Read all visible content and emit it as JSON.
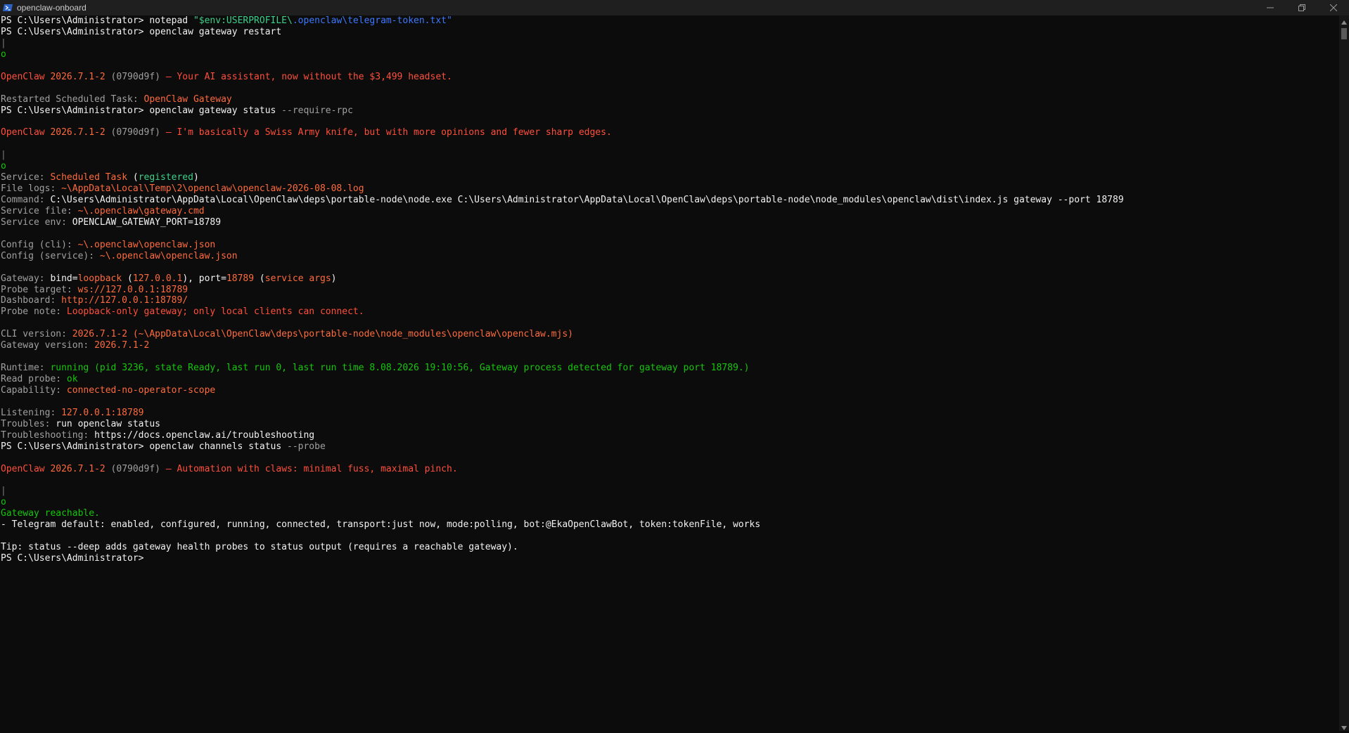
{
  "window": {
    "title": "openclaw-onboard",
    "icons": {
      "app": "powershell-icon",
      "minimize": "minimize-icon",
      "restore": "restore-icon",
      "close": "close-icon"
    }
  },
  "terminal": {
    "colors": {
      "background": "#0c0c0c",
      "text": "#cccccc",
      "accent_orange": "#ff6b3d",
      "accent_red": "#ff4f3b",
      "success_green": "#16c60c",
      "prompt_white": "#f2f2f2"
    },
    "lines": [
      [
        {
          "t": "PS C:\\Users\\Administrator> ",
          "c": "w"
        },
        {
          "t": "notepad ",
          "c": "w"
        },
        {
          "t": "\"$env:USERPROFILE\\",
          "c": "gs"
        },
        {
          "t": ".openclaw\\telegram-token.txt\"",
          "c": "bl"
        }
      ],
      [
        {
          "t": "PS C:\\Users\\Administrator> ",
          "c": "w"
        },
        {
          "t": "openclaw gateway restart",
          "c": "w"
        }
      ],
      [
        {
          "t": "|",
          "c": "dim"
        }
      ],
      [
        {
          "t": "o",
          "c": "gr"
        }
      ],
      [],
      [
        {
          "t": "OpenClaw ",
          "c": "or"
        },
        {
          "t": "2026.7.1-2 ",
          "c": "o"
        },
        {
          "t": "(0790d9f) ",
          "c": "g"
        },
        {
          "t": "— Your AI assistant, now without the $3,499 headset.",
          "c": "or"
        }
      ],
      [],
      [
        {
          "t": "Restarted Scheduled Task: ",
          "c": "g"
        },
        {
          "t": "OpenClaw Gateway",
          "c": "o"
        }
      ],
      [
        {
          "t": "PS C:\\Users\\Administrator> ",
          "c": "w"
        },
        {
          "t": "openclaw gateway status ",
          "c": "w"
        },
        {
          "t": "--require-rpc",
          "c": "g"
        }
      ],
      [],
      [
        {
          "t": "OpenClaw ",
          "c": "or"
        },
        {
          "t": "2026.7.1-2 ",
          "c": "o"
        },
        {
          "t": "(0790d9f) ",
          "c": "g"
        },
        {
          "t": "— I'm basically a Swiss Army knife, but with more opinions and fewer sharp edges.",
          "c": "or"
        }
      ],
      [],
      [
        {
          "t": "|",
          "c": "dim"
        }
      ],
      [
        {
          "t": "o",
          "c": "gr"
        }
      ],
      [
        {
          "t": "Service: ",
          "c": "g"
        },
        {
          "t": "Scheduled Task ",
          "c": "o"
        },
        {
          "t": "(",
          "c": "w"
        },
        {
          "t": "registered",
          "c": "gs"
        },
        {
          "t": ")",
          "c": "w"
        }
      ],
      [
        {
          "t": "File logs: ",
          "c": "g"
        },
        {
          "t": "~\\AppData\\Local\\Temp\\2\\openclaw\\openclaw-2026-08-08.log",
          "c": "o"
        }
      ],
      [
        {
          "t": "Command: ",
          "c": "g"
        },
        {
          "t": "C:\\Users\\Administrator\\AppData\\Local\\OpenClaw\\deps\\portable-node\\node.exe C:\\Users\\Administrator\\AppData\\Local\\OpenClaw\\deps\\portable-node\\node_modules\\openclaw\\dist\\index.js gateway --port 18789",
          "c": "w"
        }
      ],
      [
        {
          "t": "Service file: ",
          "c": "g"
        },
        {
          "t": "~\\.openclaw\\gateway.cmd",
          "c": "o"
        }
      ],
      [
        {
          "t": "Service env: ",
          "c": "g"
        },
        {
          "t": "OPENCLAW_GATEWAY_PORT=18789",
          "c": "w"
        }
      ],
      [],
      [
        {
          "t": "Config (cli): ",
          "c": "g"
        },
        {
          "t": "~\\.openclaw\\openclaw.json",
          "c": "o"
        }
      ],
      [
        {
          "t": "Config (service): ",
          "c": "g"
        },
        {
          "t": "~\\.openclaw\\openclaw.json",
          "c": "o"
        }
      ],
      [],
      [
        {
          "t": "Gateway: ",
          "c": "g"
        },
        {
          "t": "bind=",
          "c": "w"
        },
        {
          "t": "loopback ",
          "c": "o"
        },
        {
          "t": "(",
          "c": "w"
        },
        {
          "t": "127.0.0.1",
          "c": "o"
        },
        {
          "t": "), port=",
          "c": "w"
        },
        {
          "t": "18789 ",
          "c": "o"
        },
        {
          "t": "(",
          "c": "w"
        },
        {
          "t": "service args",
          "c": "o"
        },
        {
          "t": ")",
          "c": "w"
        }
      ],
      [
        {
          "t": "Probe target: ",
          "c": "g"
        },
        {
          "t": "ws://127.0.0.1:18789",
          "c": "o"
        }
      ],
      [
        {
          "t": "Dashboard: ",
          "c": "g"
        },
        {
          "t": "http://127.0.0.1:18789/",
          "c": "o"
        }
      ],
      [
        {
          "t": "Probe note: ",
          "c": "g"
        },
        {
          "t": "Loopback-only gateway; only local clients can connect.",
          "c": "or"
        }
      ],
      [],
      [
        {
          "t": "CLI version: ",
          "c": "g"
        },
        {
          "t": "2026.7.1-2 (~\\AppData\\Local\\OpenClaw\\deps\\portable-node\\node_modules\\openclaw\\openclaw.mjs)",
          "c": "o"
        }
      ],
      [
        {
          "t": "Gateway version: ",
          "c": "g"
        },
        {
          "t": "2026.7.1-2",
          "c": "o"
        }
      ],
      [],
      [
        {
          "t": "Runtime: ",
          "c": "g"
        },
        {
          "t": "running (pid 3236, state Ready, last run 0, last run time 8.08.2026 19:10:56, Gateway process detected for gateway port 18789.)",
          "c": "gr"
        }
      ],
      [
        {
          "t": "Read probe: ",
          "c": "g"
        },
        {
          "t": "ok",
          "c": "gr"
        }
      ],
      [
        {
          "t": "Capability: ",
          "c": "g"
        },
        {
          "t": "connected-no-operator-scope",
          "c": "o"
        }
      ],
      [],
      [
        {
          "t": "Listening: ",
          "c": "g"
        },
        {
          "t": "127.0.0.1:18789",
          "c": "o"
        }
      ],
      [
        {
          "t": "Troubles: ",
          "c": "g"
        },
        {
          "t": "run openclaw status",
          "c": "w"
        }
      ],
      [
        {
          "t": "Troubleshooting: ",
          "c": "g"
        },
        {
          "t": "https://docs.openclaw.ai/troubleshooting",
          "c": "w"
        }
      ],
      [
        {
          "t": "PS C:\\Users\\Administrator> ",
          "c": "w"
        },
        {
          "t": "openclaw channels status ",
          "c": "w"
        },
        {
          "t": "--probe",
          "c": "g"
        }
      ],
      [],
      [
        {
          "t": "OpenClaw ",
          "c": "or"
        },
        {
          "t": "2026.7.1-2 ",
          "c": "o"
        },
        {
          "t": "(0790d9f) ",
          "c": "g"
        },
        {
          "t": "— Automation with claws: minimal fuss, maximal pinch.",
          "c": "or"
        }
      ],
      [],
      [
        {
          "t": "|",
          "c": "dim"
        }
      ],
      [
        {
          "t": "o",
          "c": "gr"
        }
      ],
      [
        {
          "t": "Gateway reachable.",
          "c": "gr"
        }
      ],
      [
        {
          "t": "- Telegram default: enabled, configured, running, connected, transport:just now, mode:polling, bot:@EkaOpenClawBot, token:tokenFile, works",
          "c": "w"
        }
      ],
      [],
      [
        {
          "t": "Tip: status --deep adds gateway health probes to status output (requires a reachable gateway).",
          "c": "w"
        }
      ],
      [
        {
          "t": "PS C:\\Users\\Administrator>",
          "c": "w"
        }
      ]
    ]
  }
}
